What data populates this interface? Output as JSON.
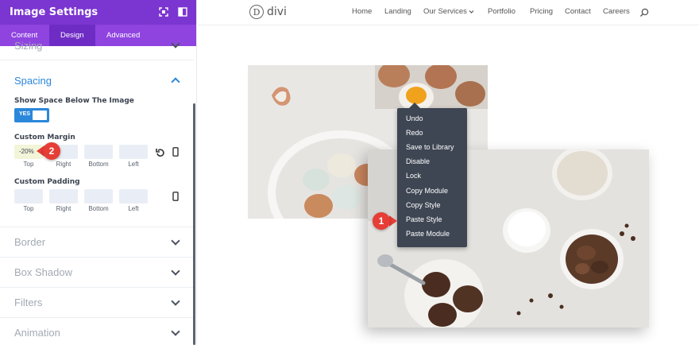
{
  "panel": {
    "title": "Image Settings",
    "tabs": [
      "Content",
      "Design",
      "Advanced"
    ],
    "sections": {
      "sizing": "Sizing",
      "spacing": "Spacing",
      "border": "Border",
      "box_shadow": "Box Shadow",
      "filters": "Filters",
      "animation": "Animation"
    },
    "show_space": {
      "label": "Show Space Below The Image",
      "toggle": "YES"
    },
    "custom_margin": {
      "label": "Custom Margin",
      "top_value": "-20%"
    },
    "custom_padding": {
      "label": "Custom Padding"
    },
    "side_labels": [
      "Top",
      "Right",
      "Bottom",
      "Left"
    ]
  },
  "badges": [
    "2",
    "1"
  ],
  "site": {
    "logo": "divi",
    "logo_mark": "D",
    "nav": [
      "Home",
      "Landing",
      "Our Services",
      "Portfolio",
      "Pricing",
      "Contact",
      "Careers"
    ]
  },
  "context_menu": [
    "Undo",
    "Redo",
    "Save to Library",
    "Disable",
    "Lock",
    "Copy Module",
    "Copy Style",
    "Paste Style",
    "Paste Module"
  ],
  "colors": {
    "accent": "#2b87da",
    "panel_header": "#7b35d1",
    "badge": "#e63d36",
    "menu_bg": "#3e4653"
  }
}
